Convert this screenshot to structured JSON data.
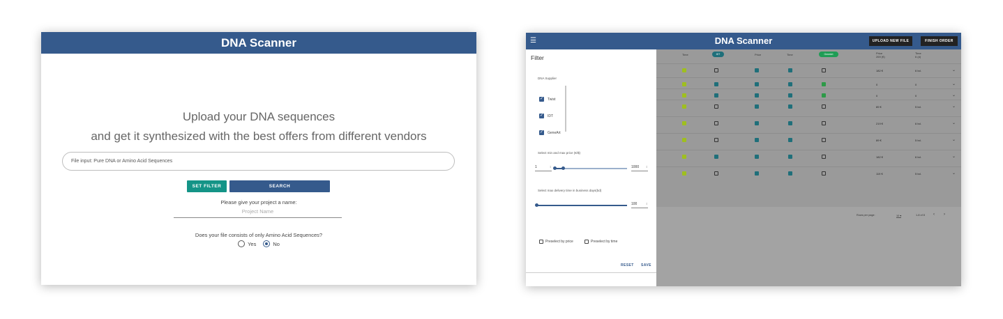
{
  "left": {
    "title": "DNA Scanner",
    "headline1": "Upload your DNA sequences",
    "headline2": "and get it synthesized with the best offers from different vendors",
    "file_input_placeholder": "File input: Pure DNA or Amino Acid Sequences",
    "set_filter_label": "SET FILTER",
    "search_label": "SEARCH",
    "project_label": "Please give your project a name:",
    "project_placeholder": "Project Name",
    "amino_question": "Does your file consists of only Amino Acid Sequences?",
    "radio_yes": "Yes",
    "radio_no": "No",
    "selected_radio": "No"
  },
  "right": {
    "title": "DNA Scanner",
    "menu_icon": "hamburger-menu-icon",
    "upload_label": "UPLOAD NEW FILE",
    "finish_label": "FINISH ORDER",
    "columns": {
      "time1": "Time",
      "idt": "IDT",
      "price": "Price",
      "time2": "Time",
      "geneart": "GeneArt",
      "price_total": "Price",
      "price_total_sub": "269 (€)",
      "time_total": "Time",
      "time_total_sub": "6 (d)"
    },
    "rows": [
      {
        "price": "182 €",
        "time": "6 bd."
      },
      {
        "price": "0",
        "time": "0"
      },
      {
        "price": "0",
        "time": "0"
      },
      {
        "price": "89 €",
        "time": "5 bd."
      },
      {
        "price": "219 €",
        "time": "6 bd."
      },
      {
        "price": "89 €",
        "time": "5 bd."
      },
      {
        "price": "182 €",
        "time": "6 bd."
      },
      {
        "price": "119 €",
        "time": "5 bd."
      }
    ],
    "rows_per_page_label": "Rows per page:",
    "rows_per_page_value": "10",
    "range_text": "1-8 of 8",
    "filter": {
      "title": "Filter",
      "supplier_label": "DNA Supplier",
      "suppliers": [
        "Twist",
        "IDT",
        "GeneArt"
      ],
      "price_label": "Select min and max price (€/$)",
      "price_min": "1",
      "price_max": "1000",
      "time_label": "Select max delivery time in business days(bd)",
      "time_max": "100",
      "preselect_price": "Preselect by price",
      "preselect_time": "Preselect by time",
      "reset": "RESET",
      "save": "SAVE"
    },
    "colors": {
      "header": "#355a8c",
      "teal": "#149487",
      "green_pill": "#1f9d55",
      "lime_icon": "#9fbf1f",
      "teal_icon": "#1f6f7a",
      "green_icon": "#2e9a48"
    }
  }
}
